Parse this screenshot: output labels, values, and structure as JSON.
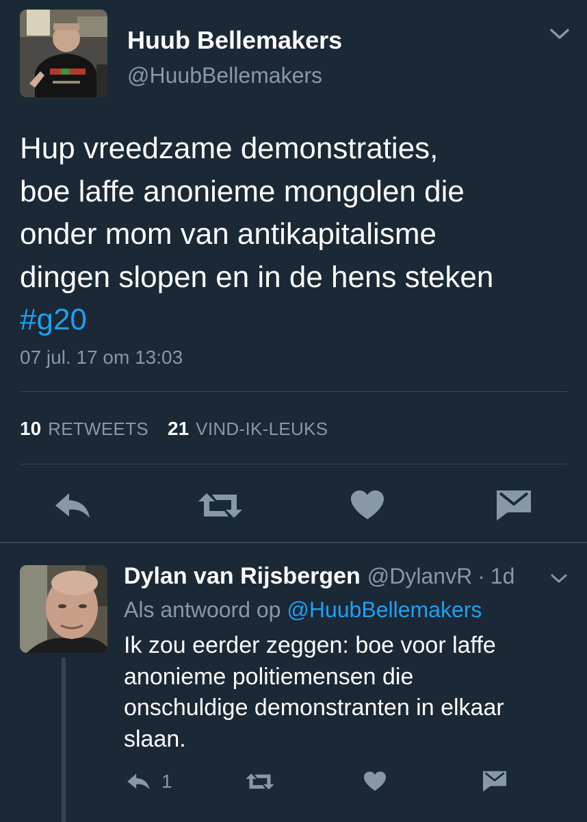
{
  "tweet": {
    "author_name": "Huub Bellemakers",
    "author_handle": "@HuubBellemakers",
    "text_lines": [
      "Hup vreedzame demonstraties,",
      "boe laffe anonieme mongolen die",
      "onder mom van antikapitalisme",
      "dingen slopen en in de hens steken"
    ],
    "hashtag": "#g20",
    "timestamp": "07 jul. 17 om 13:03",
    "stats": {
      "retweets_count": "10",
      "retweets_label": "RETWEETS",
      "likes_count": "21",
      "likes_label": "VIND-IK-LEUKS"
    },
    "actions": [
      "reply-icon",
      "retweet-icon",
      "heart-icon",
      "message-icon"
    ]
  },
  "reply": {
    "author_name": "Dylan van Rijsbergen",
    "author_handle": "@DylanvR",
    "separator": "·",
    "age": "1d",
    "context_prefix": "Als antwoord op",
    "context_mention": "@HuubBellemakers",
    "text_lines": [
      "Ik zou eerder zeggen: boe voor laffe",
      "anonieme politiemensen die",
      "onschuldige demonstranten in elkaar",
      "slaan."
    ],
    "reply_count": "1",
    "actions": [
      "reply-icon",
      "retweet-icon",
      "heart-icon",
      "message-icon"
    ]
  },
  "colors": {
    "background": "#1b2836",
    "secondary_text": "#8899a6",
    "link": "#1da1f2",
    "divider": "#38444d"
  }
}
